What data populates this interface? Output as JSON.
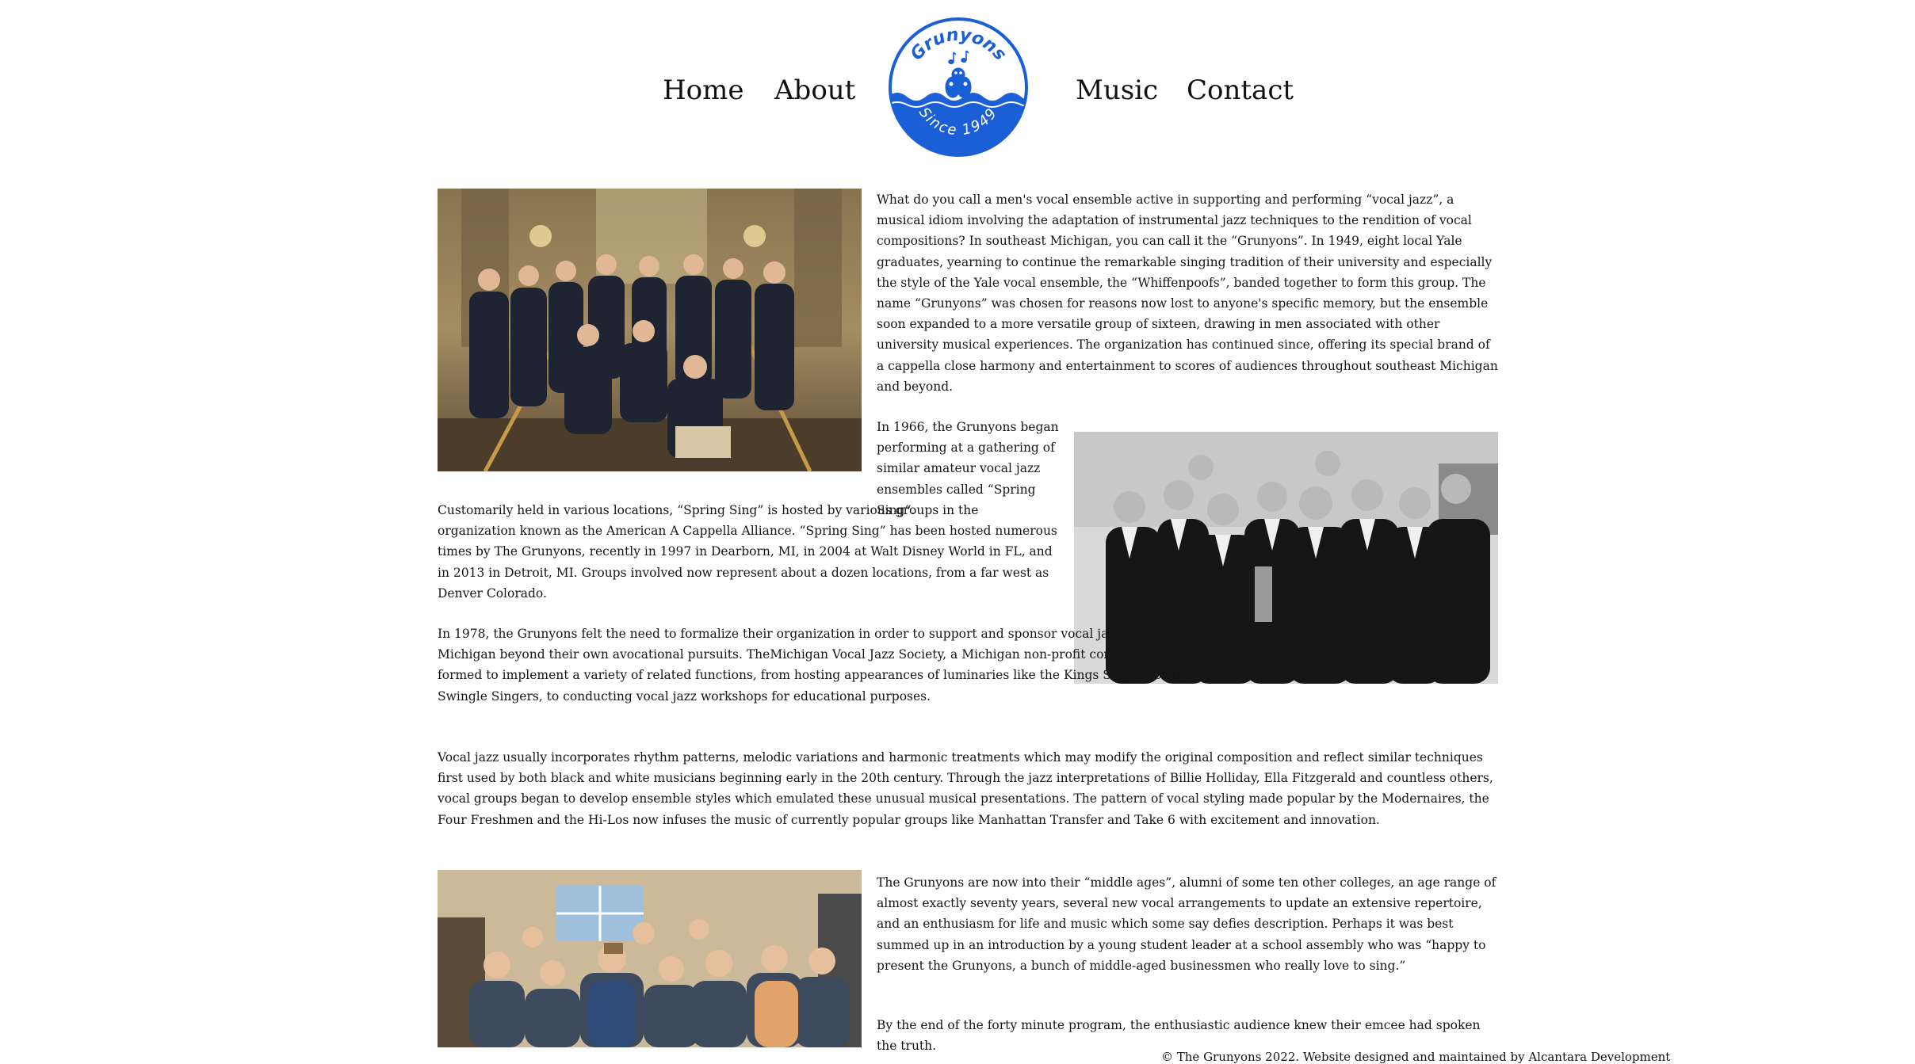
{
  "nav": {
    "home": "Home",
    "about": "About",
    "music": "Music",
    "contact": "Contact"
  },
  "logo": {
    "top_text": "Grunyons",
    "bottom_text": "Since 1949",
    "color": "#1a5fd6"
  },
  "content": {
    "p1": "What do you call a men's vocal ensemble active in supporting and performing “vocal jazz”, a musical idiom involving the adaptation of instrumental jazz techniques to the rendition of vocal compositions? In southeast Michigan, you can call it the “Grunyons”. In 1949, eight local Yale graduates, yearning to continue the remarkable singing tradition of their university and especially the style of the Yale vocal ensemble, the “Whiffenpoofs”, banded together to form this group. The name “Grunyons” was chosen for reasons now lost to anyone's specific memory, but the ensemble soon expanded to a more versatile group of sixteen, drawing in men associated with other university musical experiences. The organization has continued since, offering its special brand of a cappella close harmony and entertainment to scores of audiences throughout southeast Michigan and beyond.",
    "p2a": "In 1966, the Grunyons began performing at a gathering of similar amateur vocal jazz ensembles called “Spring Sing“.",
    "p2b": "Customarily held in various locations, “Spring Sing” is hosted by various groups in the organization known as the American A Cappella Alliance. “Spring Sing” has been hosted numerous times by The Grunyons, recently in 1997 in Dearborn, MI, in 2004 at Walt Disney World in FL, and in 2013 in Detroit, MI. Groups involved now represent about a dozen locations, from a far west as Denver Colorado.",
    "p3": "In 1978, the Grunyons felt the need to formalize their organization in order to support and sponsor vocal jazz activities in Michigan beyond their own avocational pursuits. TheMichigan Vocal Jazz Society, a Michigan non-profit corporation, was formed to implement a variety of related functions, from hosting appearances of luminaries like the Kings Singers or the Swingle Singers, to conducting vocal jazz workshops for educational purposes.",
    "p4": "Vocal jazz usually incorporates rhythm patterns, melodic variations and harmonic treatments which may modify the original composition and reflect similar techniques first used by both black and white musicians beginning early in the 20th century. Through the jazz interpretations of Billie Holliday, Ella Fitzgerald and countless others, vocal groups began to develop ensemble styles which emulated these unusual musical presentations. The pattern of vocal styling made popular by the Modernaires, the Four Freshmen and the Hi-Los now infuses the music of currently popular groups like Manhattan Transfer and Take 6 with excitement and innovation.",
    "p5": "The Grunyons are now into their “middle ages”, alumni of some ten other colleges, an age range of almost exactly seventy years, several new vocal arrangements to update an extensive repertoire, and an enthusiasm for life and music which some say defies description. Perhaps it was best summed up in an introduction by a young student leader at a school assembly who was “happy to present the Grunyons, a bunch of middle-aged businessmen who really love to sing.”",
    "p6": "By the end of the forty minute program, the enthusiastic audience knew their emcee had spoken the truth."
  },
  "footer": "© The Grunyons 2022. Website designed and maintained by Alcantara Development",
  "colors": {
    "logo_blue": "#1a5fd6",
    "text": "#151515",
    "background": "#ffffff"
  }
}
